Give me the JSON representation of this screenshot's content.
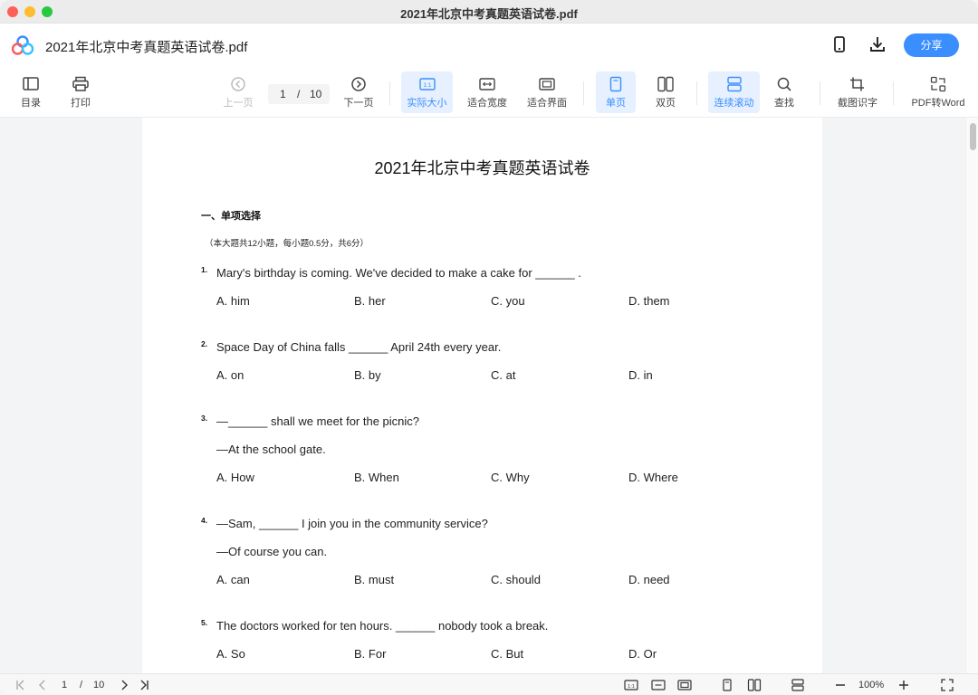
{
  "window": {
    "title": "2021年北京中考真题英语试卷.pdf"
  },
  "header": {
    "doc_title": "2021年北京中考真题英语试卷.pdf",
    "share_label": "分享"
  },
  "toolbar": {
    "toc": "目录",
    "print": "打印",
    "prev": "上一页",
    "current_page": "1",
    "page_sep": "/",
    "total_pages": "10",
    "next": "下一页",
    "actual_size": "实际大小",
    "fit_width": "适合宽度",
    "fit_page": "适合界面",
    "single_page": "单页",
    "double_page": "双页",
    "continuous": "连续滚动",
    "find": "查找",
    "ocr": "截图识字",
    "to_word": "PDF转Word",
    "actual_size_icon_text": "1:1"
  },
  "document": {
    "title": "2021年北京中考真题英语试卷",
    "section": "一、单项选择",
    "instruction": "（本大题共12小题，每小题0.5分，共6分）",
    "questions": [
      {
        "num": "1.",
        "lines": [
          "Mary's birthday is coming. We've decided to make a cake for ______ ."
        ],
        "options": [
          "A. him",
          "B. her",
          "C. you",
          "D. them"
        ]
      },
      {
        "num": "2.",
        "lines": [
          "Space Day of China falls ______ April 24th every year."
        ],
        "options": [
          "A. on",
          "B. by",
          "C. at",
          "D. in"
        ]
      },
      {
        "num": "3.",
        "lines": [
          "—______ shall we meet for the picnic?",
          "—At the school gate."
        ],
        "options": [
          "A. How",
          "B. When",
          "C. Why",
          "D. Where"
        ]
      },
      {
        "num": "4.",
        "lines": [
          "—Sam, ______ I join you in the community service?",
          "—Of course you can."
        ],
        "options": [
          "A. can",
          "B. must",
          "C. should",
          "D. need"
        ]
      },
      {
        "num": "5.",
        "lines": [
          "The doctors worked for ten hours. ______ nobody took a break."
        ],
        "options": [
          "A. So",
          "B. For",
          "C. But",
          "D. Or"
        ]
      }
    ]
  },
  "statusbar": {
    "current_page": "1",
    "page_sep": "/",
    "total_pages": "10",
    "zoom": "100%",
    "actual_size_icon_text": "1:1"
  },
  "colors": {
    "accent": "#3a8eff",
    "active_bg": "#e6f0ff"
  }
}
